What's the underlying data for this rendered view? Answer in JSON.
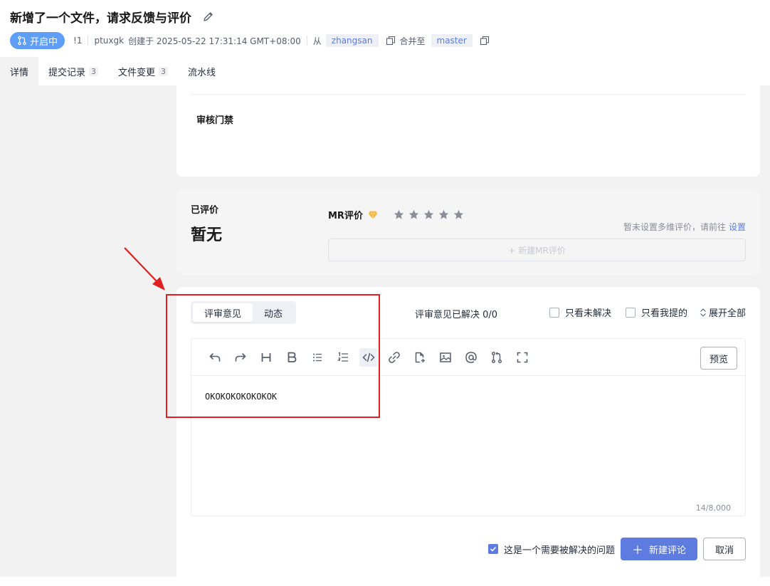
{
  "header": {
    "title": "新增了一个文件，请求反馈与评价",
    "status": "开启中",
    "mr_id": "!1",
    "author": "ptuxgk",
    "created_label": "创建于 2025-05-22 17:31:14 GMT+08:00",
    "from_label": "从",
    "source_branch": "zhangsan",
    "merge_to_label": "合并至",
    "target_branch": "master"
  },
  "tabs": [
    {
      "label": "详情",
      "count": ""
    },
    {
      "label": "提交记录",
      "count": "3"
    },
    {
      "label": "文件变更",
      "count": "3"
    },
    {
      "label": "流水线",
      "count": ""
    }
  ],
  "review_gate": {
    "label": "审核门禁"
  },
  "rating": {
    "rated_label": "已评价",
    "rated_value": "暂无",
    "mr_rating_label": "MR评价",
    "hint_text": "暂未设置多维评价，请前往",
    "hint_link": "设置",
    "new_rating_label": "+ 新建MR评价"
  },
  "comments": {
    "seg_tabs": [
      "评审意见",
      "动态"
    ],
    "resolved_text": "评审意见已解决 0/0",
    "filter_unresolved": "只看未解决",
    "filter_mine": "只看我提的",
    "expand_all": "展开全部",
    "preview_label": "预览",
    "editor_text": "OKOKOKOKOKOKOK",
    "counter": "14/8,000",
    "needs_resolve_label": "这是一个需要被解决的问题",
    "new_comment_label": "新建评论",
    "cancel_label": "取消"
  },
  "colors": {
    "status_pill": "#5e9ef7",
    "primary": "#5e7ce0",
    "annotation": "#e02020"
  },
  "toolbar_icons": [
    "undo-icon",
    "redo-icon",
    "heading-icon",
    "bold-icon",
    "bullet-list-icon",
    "ordered-list-icon",
    "code-icon",
    "link-icon",
    "attachment-icon",
    "image-icon",
    "mention-icon",
    "merge-request-icon",
    "fullscreen-icon"
  ]
}
